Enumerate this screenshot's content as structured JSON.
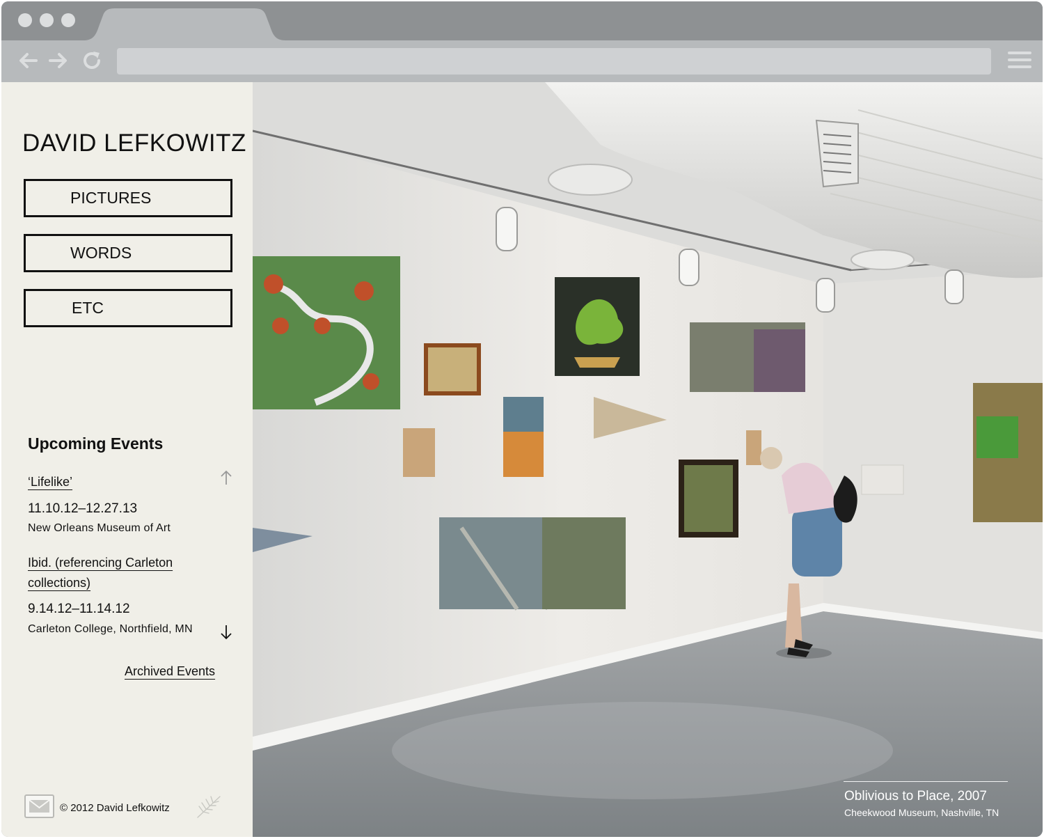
{
  "browser": {
    "window_controls": [
      "close",
      "minimize",
      "maximize"
    ],
    "url": "",
    "nav_icons": [
      "back-arrow-icon",
      "forward-arrow-icon",
      "reload-icon",
      "hamburger-menu-icon"
    ]
  },
  "sidebar": {
    "site_title": "DAVID LEFKOWITZ",
    "nav": [
      {
        "label": "PICTURES"
      },
      {
        "label": "WORDS"
      },
      {
        "label": "ETC"
      }
    ],
    "events_heading": "Upcoming Events",
    "events": [
      {
        "title": "‘Lifelike’",
        "dates": "11.10.12–12.27.13",
        "venue": "New Orleans Museum of Art"
      },
      {
        "title_line1": "Ibid. (referencing Carleton",
        "title_line2": "collections)",
        "dates": "9.14.12–11.14.12",
        "venue": "Carleton College, Northfield, MN"
      }
    ],
    "archived_link": "Archived Events",
    "copyright": "© 2012 David Lefkowitz",
    "footer_icons": [
      "mail-icon",
      "wheat-leaf-icon"
    ]
  },
  "photo": {
    "caption_title": "Oblivious to Place, 2007",
    "caption_subtitle": "Cheekwood Museum, Nashville, TN"
  },
  "colors": {
    "chrome": "#8e9193",
    "toolbar": "#b7babc",
    "sidebar_bg": "#f0efe8",
    "text": "#111111"
  }
}
